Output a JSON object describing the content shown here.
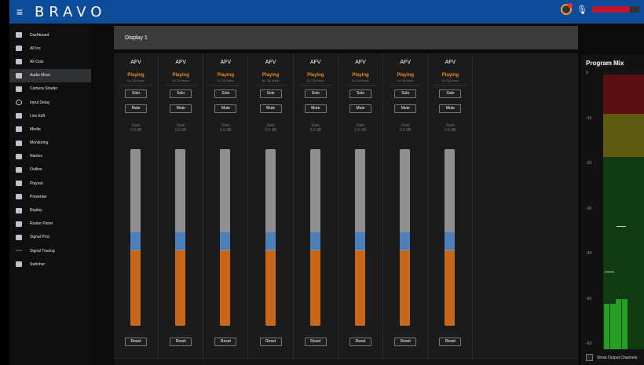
{
  "app": {
    "logo": "BRAVO"
  },
  "topbar": {
    "menu_icon": "hamburger-icon",
    "status_icon": "media-status-icon",
    "mic_icon": "mic-muted-icon",
    "audio_level_pct": 80
  },
  "sidebar": {
    "items": [
      {
        "label": "Dashboard",
        "icon": "dashboard-icon",
        "active": false
      },
      {
        "label": "All Ins",
        "icon": "inputs-icon",
        "active": false
      },
      {
        "label": "All Outs",
        "icon": "outputs-icon",
        "active": false
      },
      {
        "label": "Audio Mixer",
        "icon": "audio-mixer-icon",
        "active": true
      },
      {
        "label": "Camera Shader",
        "icon": "camera-shader-icon",
        "active": false
      },
      {
        "label": "Input Delay",
        "icon": "timer-icon",
        "active": false
      },
      {
        "label": "Live Edit",
        "icon": "live-edit-icon",
        "active": false
      },
      {
        "label": "Media",
        "icon": "media-icon",
        "active": false
      },
      {
        "label": "Monitoring",
        "icon": "monitoring-icon",
        "active": false
      },
      {
        "label": "Names",
        "icon": "names-icon",
        "active": false
      },
      {
        "label": "Outline",
        "icon": "outline-icon",
        "active": false
      },
      {
        "label": "Playout",
        "icon": "playout-icon",
        "active": false
      },
      {
        "label": "Presenter",
        "icon": "presenter-icon",
        "active": false
      },
      {
        "label": "Replay",
        "icon": "replay-icon",
        "active": false
      },
      {
        "label": "Router Panel",
        "icon": "router-icon",
        "active": false
      },
      {
        "label": "Signal Proc",
        "icon": "signal-proc-icon",
        "active": false
      },
      {
        "label": "Signal Tracing",
        "icon": "signal-tracing-icon",
        "active": false
      },
      {
        "label": "Switcher",
        "icon": "switcher-icon",
        "active": false
      }
    ]
  },
  "main": {
    "display_title": "Display 1",
    "channels": [
      {
        "title": "AFV",
        "state": "Playing",
        "clip": "No Clip Name",
        "solo": "Solo",
        "mute": "Mute",
        "gain_label": "Gain",
        "gain_value": "0.0 dB",
        "fader_level": 0.48,
        "reset": "Reset"
      },
      {
        "title": "AFV",
        "state": "Playing",
        "clip": "No Clip Name",
        "solo": "Solo",
        "mute": "Mute",
        "gain_label": "Gain",
        "gain_value": "0.0 dB",
        "fader_level": 0.48,
        "reset": "Reset"
      },
      {
        "title": "AFV",
        "state": "Playing",
        "clip": "No Clip Name",
        "solo": "Solo",
        "mute": "Mute",
        "gain_label": "Gain",
        "gain_value": "0.0 dB",
        "fader_level": 0.48,
        "reset": "Reset"
      },
      {
        "title": "AFV",
        "state": "Playing",
        "clip": "No Clip Name",
        "solo": "Solo",
        "mute": "Mute",
        "gain_label": "Gain",
        "gain_value": "0.0 dB",
        "fader_level": 0.48,
        "reset": "Reset"
      },
      {
        "title": "AFV",
        "state": "Playing",
        "clip": "No Clip Name",
        "solo": "Solo",
        "mute": "Mute",
        "gain_label": "Gain",
        "gain_value": "0.0 dB",
        "fader_level": 0.48,
        "reset": "Reset"
      },
      {
        "title": "AFV",
        "state": "Playing",
        "clip": "No Clip Name",
        "solo": "Solo",
        "mute": "Mute",
        "gain_label": "Gain",
        "gain_value": "0.0 dB",
        "fader_level": 0.48,
        "reset": "Reset"
      },
      {
        "title": "AFV",
        "state": "Playing",
        "clip": "No Clip Name",
        "solo": "Solo",
        "mute": "Mute",
        "gain_label": "Gain",
        "gain_value": "0.0 dB",
        "fader_level": 0.48,
        "reset": "Reset"
      },
      {
        "title": "AFV",
        "state": "Playing",
        "clip": "No Clip Name",
        "solo": "Solo",
        "mute": "Mute",
        "gain_label": "Gain",
        "gain_value": "0.0 dB",
        "fader_level": 0.48,
        "reset": "Reset"
      }
    ]
  },
  "program_mix": {
    "title": "Program Mix",
    "scale": [
      "0",
      "-10",
      "-20",
      "-30",
      "-40",
      "-50",
      "-60"
    ],
    "bar_levels_db": [
      -50,
      -50,
      -49,
      -49,
      -60,
      -60,
      -60
    ],
    "peak_holds_db": [
      -43,
      -33
    ],
    "show_output_label": "Show Output Channels",
    "colors": {
      "red": "#5a0f12",
      "yellow": "#5f5a12",
      "green": "#0f3a12",
      "active_green": "#23a023"
    }
  }
}
